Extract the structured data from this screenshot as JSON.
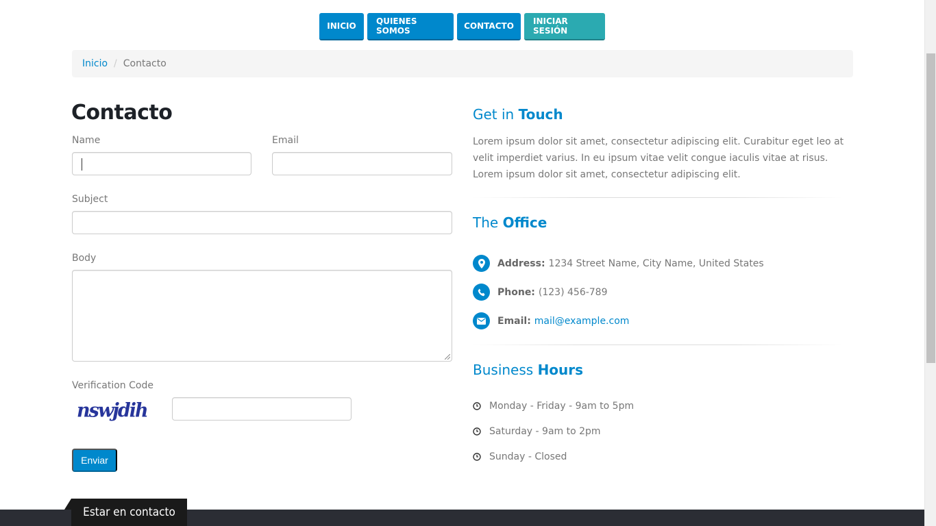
{
  "nav": {
    "items": [
      {
        "label": "INICIO"
      },
      {
        "label": "QUIENES SOMOS"
      },
      {
        "label": "CONTACTO"
      },
      {
        "label": "INICIAR SESIÓN"
      }
    ]
  },
  "breadcrumb": {
    "home": "Inicio",
    "separator": "/",
    "current": "Contacto"
  },
  "form": {
    "title": "Contacto",
    "name_label": "Name",
    "name_value": "",
    "email_label": "Email",
    "email_value": "",
    "subject_label": "Subject",
    "subject_value": "",
    "body_label": "Body",
    "body_value": "",
    "verification_label": "Verification Code",
    "captcha_text": "nswjdih",
    "verification_value": "",
    "submit_label": "Enviar"
  },
  "touch": {
    "heading_prefix": "Get in",
    "heading_strong": "Touch",
    "text": "Lorem ipsum dolor sit amet, consectetur adipiscing elit. Curabitur eget leo at velit imperdiet varius. In eu ipsum vitae velit congue iaculis vitae at risus. Lorem ipsum dolor sit amet, consectetur adipiscing elit."
  },
  "office": {
    "heading_prefix": "The",
    "heading_strong": "Office",
    "address_label": "Address:",
    "address_value": "1234 Street Name, City Name, United States",
    "phone_label": "Phone:",
    "phone_value": "(123) 456-789",
    "email_label": "Email:",
    "email_value": "mail@example.com"
  },
  "hours": {
    "heading_prefix": "Business",
    "heading_strong": "Hours",
    "items": [
      "Monday - Friday - 9am to 5pm",
      "Saturday - 9am to 2pm",
      "Sunday - Closed"
    ]
  },
  "footer": {
    "ribbon_label": "Estar en contacto"
  },
  "icons": {
    "address": "map-marker-icon",
    "phone": "phone-icon",
    "email": "envelope-icon",
    "hours": "clock-icon"
  },
  "colors": {
    "primary": "#0088cc",
    "secondary": "#2baab1",
    "heading_dark": "#1d2127",
    "footer": "#2b2d34"
  }
}
